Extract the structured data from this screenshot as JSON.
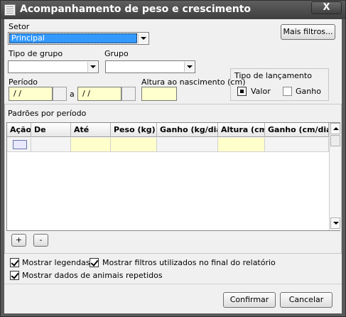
{
  "window": {
    "title": "Acompanhamento de peso e crescimento",
    "close_label": "X"
  },
  "setor": {
    "label": "Setor",
    "value": "Principal"
  },
  "mais_filtros_label": "Mais filtros...",
  "tipo_grupo": {
    "label": "Tipo de grupo",
    "value": ""
  },
  "grupo": {
    "label": "Grupo",
    "value": ""
  },
  "periodo": {
    "label": "Período",
    "start": "/ /",
    "separator": "a",
    "end": "/ /"
  },
  "altura_nascimento": {
    "label": "Altura ao nascimento (cm)",
    "value": ""
  },
  "tipo_lancamento": {
    "label": "Tipo de lançamento",
    "option_valor": "Valor",
    "option_ganho": "Ganho",
    "selected": "Valor"
  },
  "padroes": {
    "label": "Padrões por período",
    "columns": [
      "Ação",
      "De",
      "Até",
      "Peso (kg)",
      "Ganho (kg/dia)",
      "Altura (cm",
      "Ganho (cm/dia)"
    ],
    "add_label": "+",
    "remove_label": "-"
  },
  "options": {
    "mostrar_legendas": "Mostrar legendas",
    "mostrar_filtros": "Mostrar filtros utilizados no final do relatório",
    "mostrar_repetidos": "Mostrar dados de animais repetidos"
  },
  "buttons": {
    "confirmar": "Confirmar",
    "cancelar": "Cancelar"
  }
}
